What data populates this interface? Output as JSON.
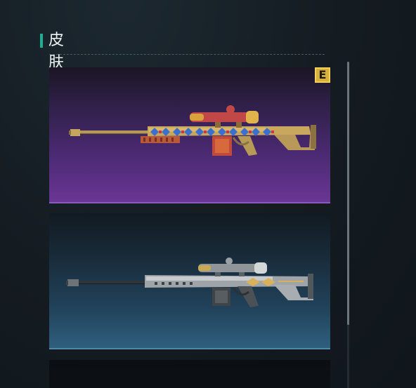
{
  "section": {
    "title": "皮肤"
  },
  "skins": [
    {
      "rarity_badge": "E"
    },
    {},
    {}
  ]
}
